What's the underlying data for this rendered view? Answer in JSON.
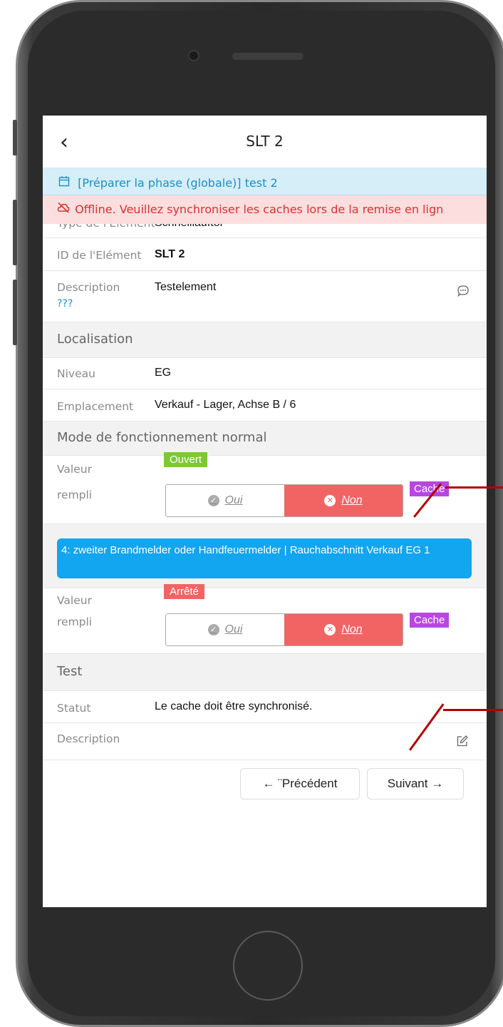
{
  "nav": {
    "back_icon": "chevron-left-icon",
    "title": "SLT 2"
  },
  "phase_banner": {
    "icon": "calendar-icon",
    "text": "[Préparer la phase (globale)] test 2"
  },
  "offline_banner": {
    "icon": "cloud-offline-icon",
    "text": "Offline. Veuillez synchroniser les caches lors de la remise en lign"
  },
  "element": {
    "type_label": "Type de l'Elément",
    "type_value": "Schnelllauftor",
    "id_label": "ID de l'Elément",
    "id_value": "SLT 2",
    "desc_label": "Description",
    "desc_sub": "???",
    "desc_value": "Testelement",
    "comment_icon": "comment-icon"
  },
  "localisation": {
    "header": "Localisation",
    "niveau_label": "Niveau",
    "niveau_value": "EG",
    "emplacement_label": "Emplacement",
    "emplacement_value": "Verkauf - Lager, Achse B / 6"
  },
  "mode_normal": {
    "header": "Mode de fonctionnement normal",
    "valeur_label": "Valeur",
    "valeur_badge": "Ouvert",
    "rempli_label": "rempli",
    "oui": "Oui",
    "non": "Non",
    "cache": "Cache"
  },
  "info_banner": "4: zweiter Brandmelder oder Handfeuermelder | Rauchabschnitt Verkauf EG 1",
  "mode_alarm": {
    "valeur_label": "Valeur",
    "valeur_badge": "Arrêté",
    "rempli_label": "rempli",
    "oui": "Oui",
    "non": "Non",
    "cache": "Cache"
  },
  "test": {
    "header": "Test",
    "statut_label": "Statut",
    "statut_value": "Le cache doit être synchronisé.",
    "desc_label": "Description",
    "edit_icon": "edit-icon"
  },
  "buttons": {
    "prev": "← ¨Précédent",
    "next": "Suivant →"
  },
  "colors": {
    "green": "#7cc934",
    "red": "#f26464",
    "purple": "#b847e0",
    "blue": "#12a5f0",
    "annotation": "#b40000"
  }
}
